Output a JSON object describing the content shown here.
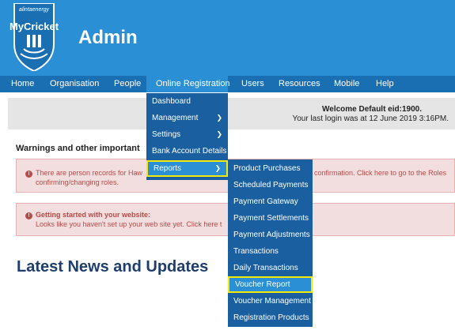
{
  "header": {
    "logo_brand": "alintaenergy",
    "logo_name": "MyCricket",
    "title": "Admin"
  },
  "nav": {
    "items": [
      "Home",
      "Organisation",
      "People",
      "Online Registration",
      "Users",
      "Resources",
      "Mobile",
      "Help"
    ]
  },
  "welcome": {
    "line1": "Welcome Default eid:1900.",
    "line2": "Your last login was at 12 June 2019 3:16PM."
  },
  "warnings": {
    "heading": "Warnings and other important",
    "alert1_line1a": "There are person records for Haw",
    "alert1_line1b": "confirmation.    Click here to go to the Roles",
    "alert1_line2": "confirming/changing roles.",
    "alert2_line1": "Getting started with your website:",
    "alert2_line2": "Looks like you haven't set up your web site yet. Click here t"
  },
  "news": {
    "heading": "Latest News and Updates"
  },
  "dropdown": {
    "items": [
      {
        "label": "Dashboard",
        "arrow": ""
      },
      {
        "label": "Management",
        "arrow": "❯"
      },
      {
        "label": "Settings",
        "arrow": "❯"
      },
      {
        "label": "Bank Account Details",
        "arrow": ""
      },
      {
        "label": "Reports",
        "arrow": "❯"
      }
    ]
  },
  "submenu": {
    "items": [
      "Product Purchases",
      "Scheduled Payments",
      "Payment Gateway",
      "Payment Settlements",
      "Payment Adjustments",
      "Transactions",
      "Daily Transactions",
      "Voucher Report",
      "Voucher Management",
      "Registration Products"
    ]
  },
  "icons": {
    "alert": "exclamation-circle-icon",
    "submenu_arrow": "chevron-right-icon"
  },
  "colors": {
    "header": "#2b8fd6",
    "navbar": "#1a6fb3",
    "menu": "#1a5fa0",
    "highlight_border": "#f5e90a",
    "alert_bg": "#f2dede",
    "alert_text": "#b94a48",
    "news_heading": "#1f3e6e"
  }
}
